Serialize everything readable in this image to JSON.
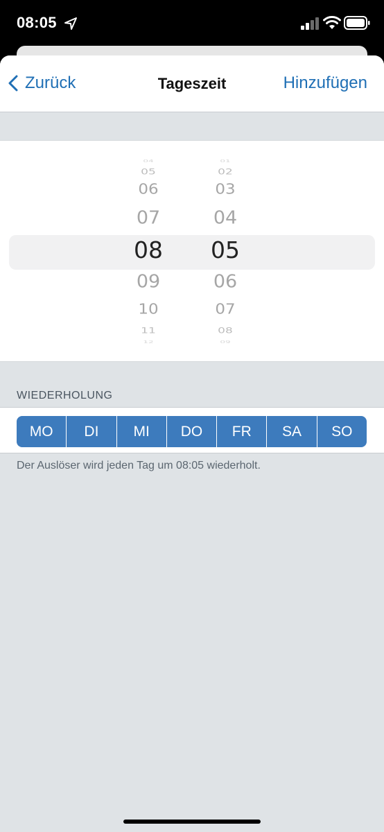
{
  "status_bar": {
    "time": "08:05"
  },
  "nav": {
    "back_label": "Zurück",
    "title": "Tageszeit",
    "add_label": "Hinzufügen"
  },
  "picker": {
    "hours": [
      "04",
      "05",
      "06",
      "07",
      "08",
      "09",
      "10",
      "11",
      "12"
    ],
    "minutes": [
      "01",
      "02",
      "03",
      "04",
      "05",
      "06",
      "07",
      "08",
      "09"
    ],
    "selected_hour": "08",
    "selected_minute": "05"
  },
  "repetition": {
    "label": "WIEDERHOLUNG",
    "days": [
      "MO",
      "DI",
      "MI",
      "DO",
      "FR",
      "SA",
      "SO"
    ],
    "info": "Der Auslöser wird jeden Tag um 08:05 wiederholt."
  },
  "colors": {
    "accent": "#1f6fb5",
    "day_button": "#3d7bbd",
    "background": "#dfe3e6"
  }
}
